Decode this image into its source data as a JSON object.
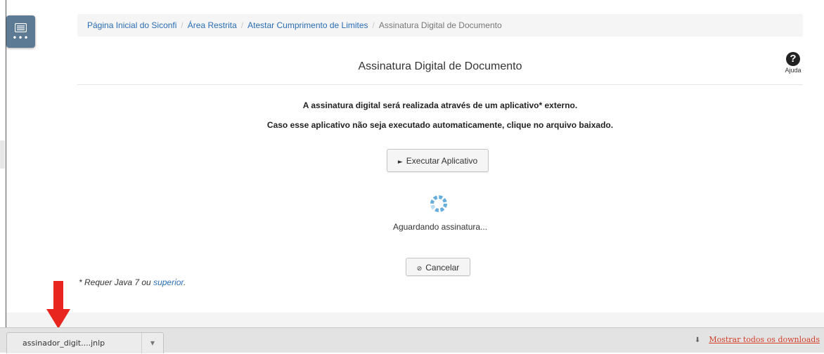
{
  "sidebar": {
    "toggle_icon": "list-icon",
    "dots": "•••"
  },
  "breadcrumb": {
    "items": [
      {
        "label": "Página Inicial do Siconfi"
      },
      {
        "label": "Área Restrita"
      },
      {
        "label": "Atestar Cumprimento de Limites"
      }
    ],
    "separator": "/",
    "current": "Assinatura Digital de Documento"
  },
  "page": {
    "title": "Assinatura Digital de Documento",
    "help": {
      "icon": "question-circle-icon",
      "label": "Ajuda"
    }
  },
  "main": {
    "info_line1": "A assinatura digital será realizada através de um aplicativo* externo.",
    "info_line2": "Caso esse aplicativo não seja executado automaticamente, clique no arquivo baixado.",
    "execute_button": {
      "icon": "play-icon",
      "glyph": "►",
      "label": "Executar Aplicativo"
    },
    "spinner_icon": "loading-spinner-icon",
    "waiting_text": "Aguardando assinatura...",
    "cancel_button": {
      "icon": "cancel-icon",
      "glyph": "⊘",
      "label": "Cancelar"
    }
  },
  "footnote": {
    "prefix": "* Requer Java 7 ou ",
    "link": "superior",
    "suffix": "."
  },
  "annotation": {
    "arrow_color": "#e8251e"
  },
  "download_bar": {
    "file_name": "assinador_digit....jnlp",
    "caret": "▼",
    "download_icon_glyph": "⬇",
    "show_all_label": "Mostrar todos os downloads"
  },
  "colors": {
    "link": "#2a6db3",
    "sidebar_toggle": "#5c7a94",
    "spinner": "#4a9fd6",
    "download_link": "#d2402a"
  }
}
